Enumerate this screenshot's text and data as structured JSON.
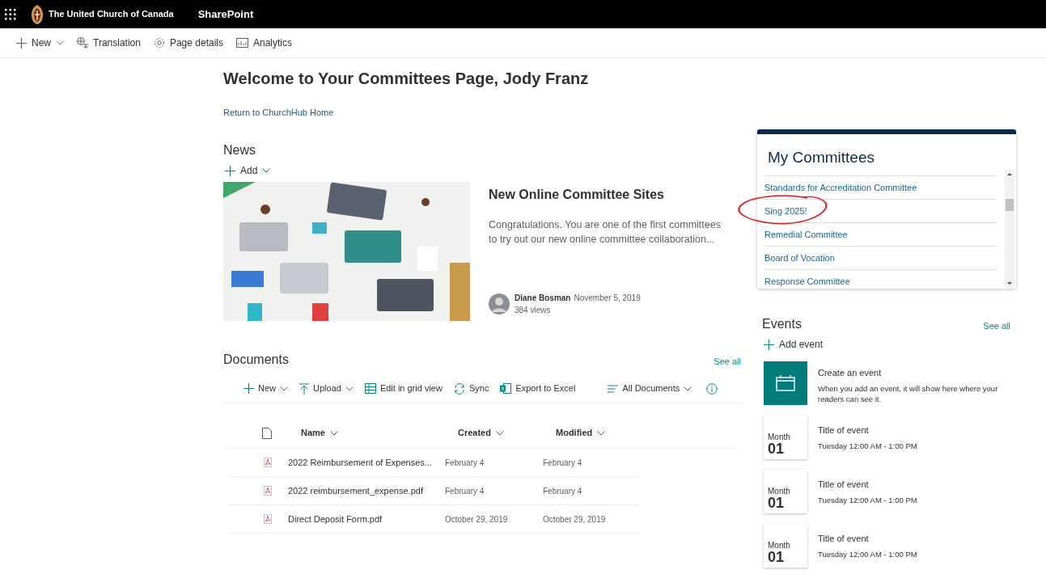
{
  "app_bar": {
    "site_name": "The United Church of Canada",
    "app_name": "SharePoint"
  },
  "command_bar": [
    {
      "label": "New",
      "kind": "plus",
      "has_menu": true
    },
    {
      "label": "Translation",
      "kind": "translate",
      "has_menu": false
    },
    {
      "label": "Page details",
      "kind": "gear",
      "has_menu": false
    },
    {
      "label": "Analytics",
      "kind": "chart",
      "has_menu": false
    }
  ],
  "page": {
    "title": "Welcome to Your Committees Page, Jody Franz",
    "link": "Return to ChurchHub Home"
  },
  "news": {
    "heading": "News",
    "add_label": "Add",
    "article": {
      "title": "New Online Committee Sites",
      "summary": "Congratulations. You are one of the first committees to try out our new online committee collaboration...",
      "author": "Diane Bosman",
      "date": "November 5, 2019",
      "views": "384 views"
    }
  },
  "documents": {
    "heading": "Documents",
    "see_all": "See all",
    "toolbar": [
      {
        "label": "New",
        "kind": "plus",
        "has_menu": true
      },
      {
        "label": "Upload",
        "kind": "upload",
        "has_menu": true
      },
      {
        "label": "Edit in grid view",
        "kind": "grid",
        "has_menu": false
      },
      {
        "label": "Sync",
        "kind": "sync",
        "has_menu": false
      },
      {
        "label": "Export to Excel",
        "kind": "excel",
        "has_menu": false
      }
    ],
    "view_label": "All Documents",
    "columns": [
      "Name",
      "Created",
      "Modified"
    ],
    "rows": [
      {
        "name": "2022 Reimbursement of Expenses...",
        "created": "February 4",
        "modified": "February 4"
      },
      {
        "name": "2022 reimbursement_expense.pdf",
        "created": "February 4",
        "modified": "February 4"
      },
      {
        "name": "Direct Deposit Form.pdf",
        "created": "October 29, 2019",
        "modified": "October 29, 2019"
      }
    ]
  },
  "committees": {
    "title": "My Committees",
    "items": [
      "Standards for Accreditation Committee",
      "Sing 2025!",
      "Remedial Committee",
      "Board of Vocation",
      "Response Committee"
    ]
  },
  "events": {
    "heading": "Events",
    "see_all": "See all",
    "add_label": "Add event",
    "empty": {
      "title": "Create an event",
      "text": "When you add an event, it will show here where your readers can see it."
    },
    "items": [
      {
        "month": "Month",
        "day": "01",
        "title": "Title of event",
        "time": "Tuesday 12:00 AM - 1:00 PM"
      },
      {
        "month": "Month",
        "day": "01",
        "title": "Title of event",
        "time": "Tuesday 12:00 AM - 1:00 PM"
      },
      {
        "month": "Month",
        "day": "01",
        "title": "Title of event",
        "time": "Tuesday 12:00 AM - 1:00 PM"
      }
    ]
  }
}
